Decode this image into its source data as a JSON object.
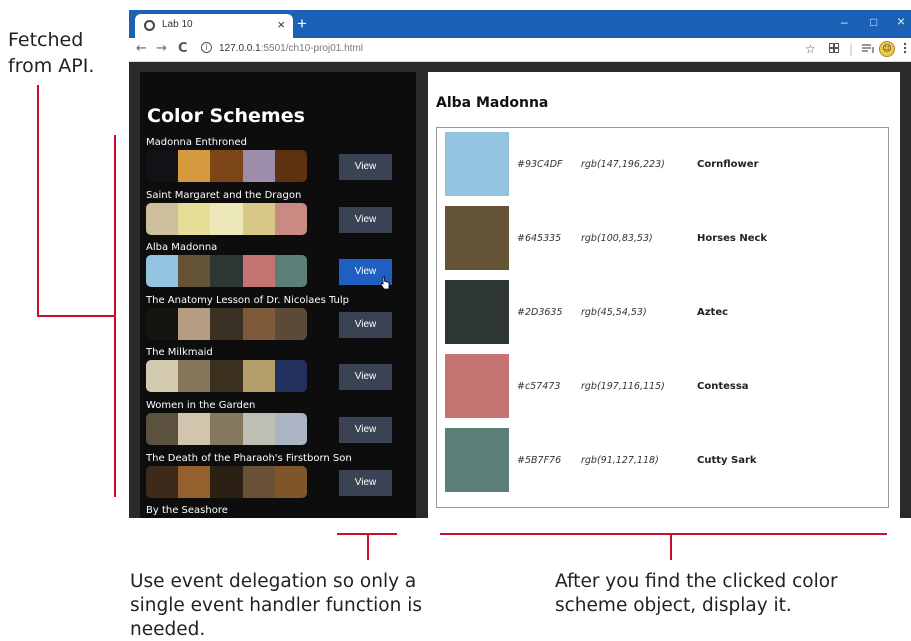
{
  "annotations": {
    "left": "Fetched from API.",
    "bottom_left": "Use event delegation so only a single event handler function is needed.",
    "bottom_right": "After you find the clicked color scheme object, display it."
  },
  "browser": {
    "tab_title": "Lab 10",
    "url_host": "127.0.0.1",
    "url_rest": ":5501/ch10-proj01.html"
  },
  "app": {
    "panel_title": "Color Schemes",
    "view_label": "View",
    "schemes": [
      {
        "name": "Madonna Enthroned",
        "colors": [
          "#141116",
          "#d59a3e",
          "#7d4617",
          "#9c8eab",
          "#5e3211"
        ]
      },
      {
        "name": "Saint Margaret and the Dragon",
        "colors": [
          "#cdbf9b",
          "#e6de97",
          "#ede8b9",
          "#d8c888",
          "#c98a83"
        ]
      },
      {
        "name": "Alba Madonna",
        "colors": [
          "#93C4DF",
          "#645335",
          "#2D3635",
          "#c57473",
          "#5B7F76"
        ],
        "active": true
      },
      {
        "name": "The Anatomy Lesson of Dr. Nicolaes Tulp",
        "colors": [
          "#16140f",
          "#b49d81",
          "#3b3024",
          "#7f5a3a",
          "#5a4a37"
        ]
      },
      {
        "name": "The Milkmaid",
        "colors": [
          "#d2c9ae",
          "#857659",
          "#3c301f",
          "#b39d68",
          "#23305f"
        ]
      },
      {
        "name": "Women in the Garden",
        "colors": [
          "#5c513f",
          "#d1c6ad",
          "#857a60",
          "#bfc0b4",
          "#aab4c3"
        ]
      },
      {
        "name": "The Death of the Pharaoh's Firstborn Son",
        "colors": [
          "#3e2a1a",
          "#93602e",
          "#2c1f14",
          "#6a5236",
          "#7e5629"
        ]
      },
      {
        "name": "By the Seashore"
      }
    ],
    "selected": {
      "title": "Alba Madonna",
      "colors": [
        {
          "hex": "#93C4DF",
          "rgb": "rgb(147,196,223)",
          "name": "Cornflower"
        },
        {
          "hex": "#645335",
          "rgb": "rgb(100,83,53)",
          "name": "Horses Neck"
        },
        {
          "hex": "#2D3635",
          "rgb": "rgb(45,54,53)",
          "name": "Aztec"
        },
        {
          "hex": "#c57473",
          "rgb": "rgb(197,116,115)",
          "name": "Contessa"
        },
        {
          "hex": "#5B7F76",
          "rgb": "rgb(91,127,118)",
          "name": "Cutty Sark"
        }
      ]
    }
  },
  "colors": {
    "tabbar": "#1b62b7",
    "annotation_line": "#c8102e",
    "view_button": "#3b4253",
    "view_button_active": "#1f5fc2"
  },
  "icons": {
    "back": "←",
    "forward": "→",
    "reload": "C",
    "info": "i",
    "star": "☆",
    "minimize": "–",
    "maximize": "□",
    "close": "×",
    "newtab": "+"
  }
}
